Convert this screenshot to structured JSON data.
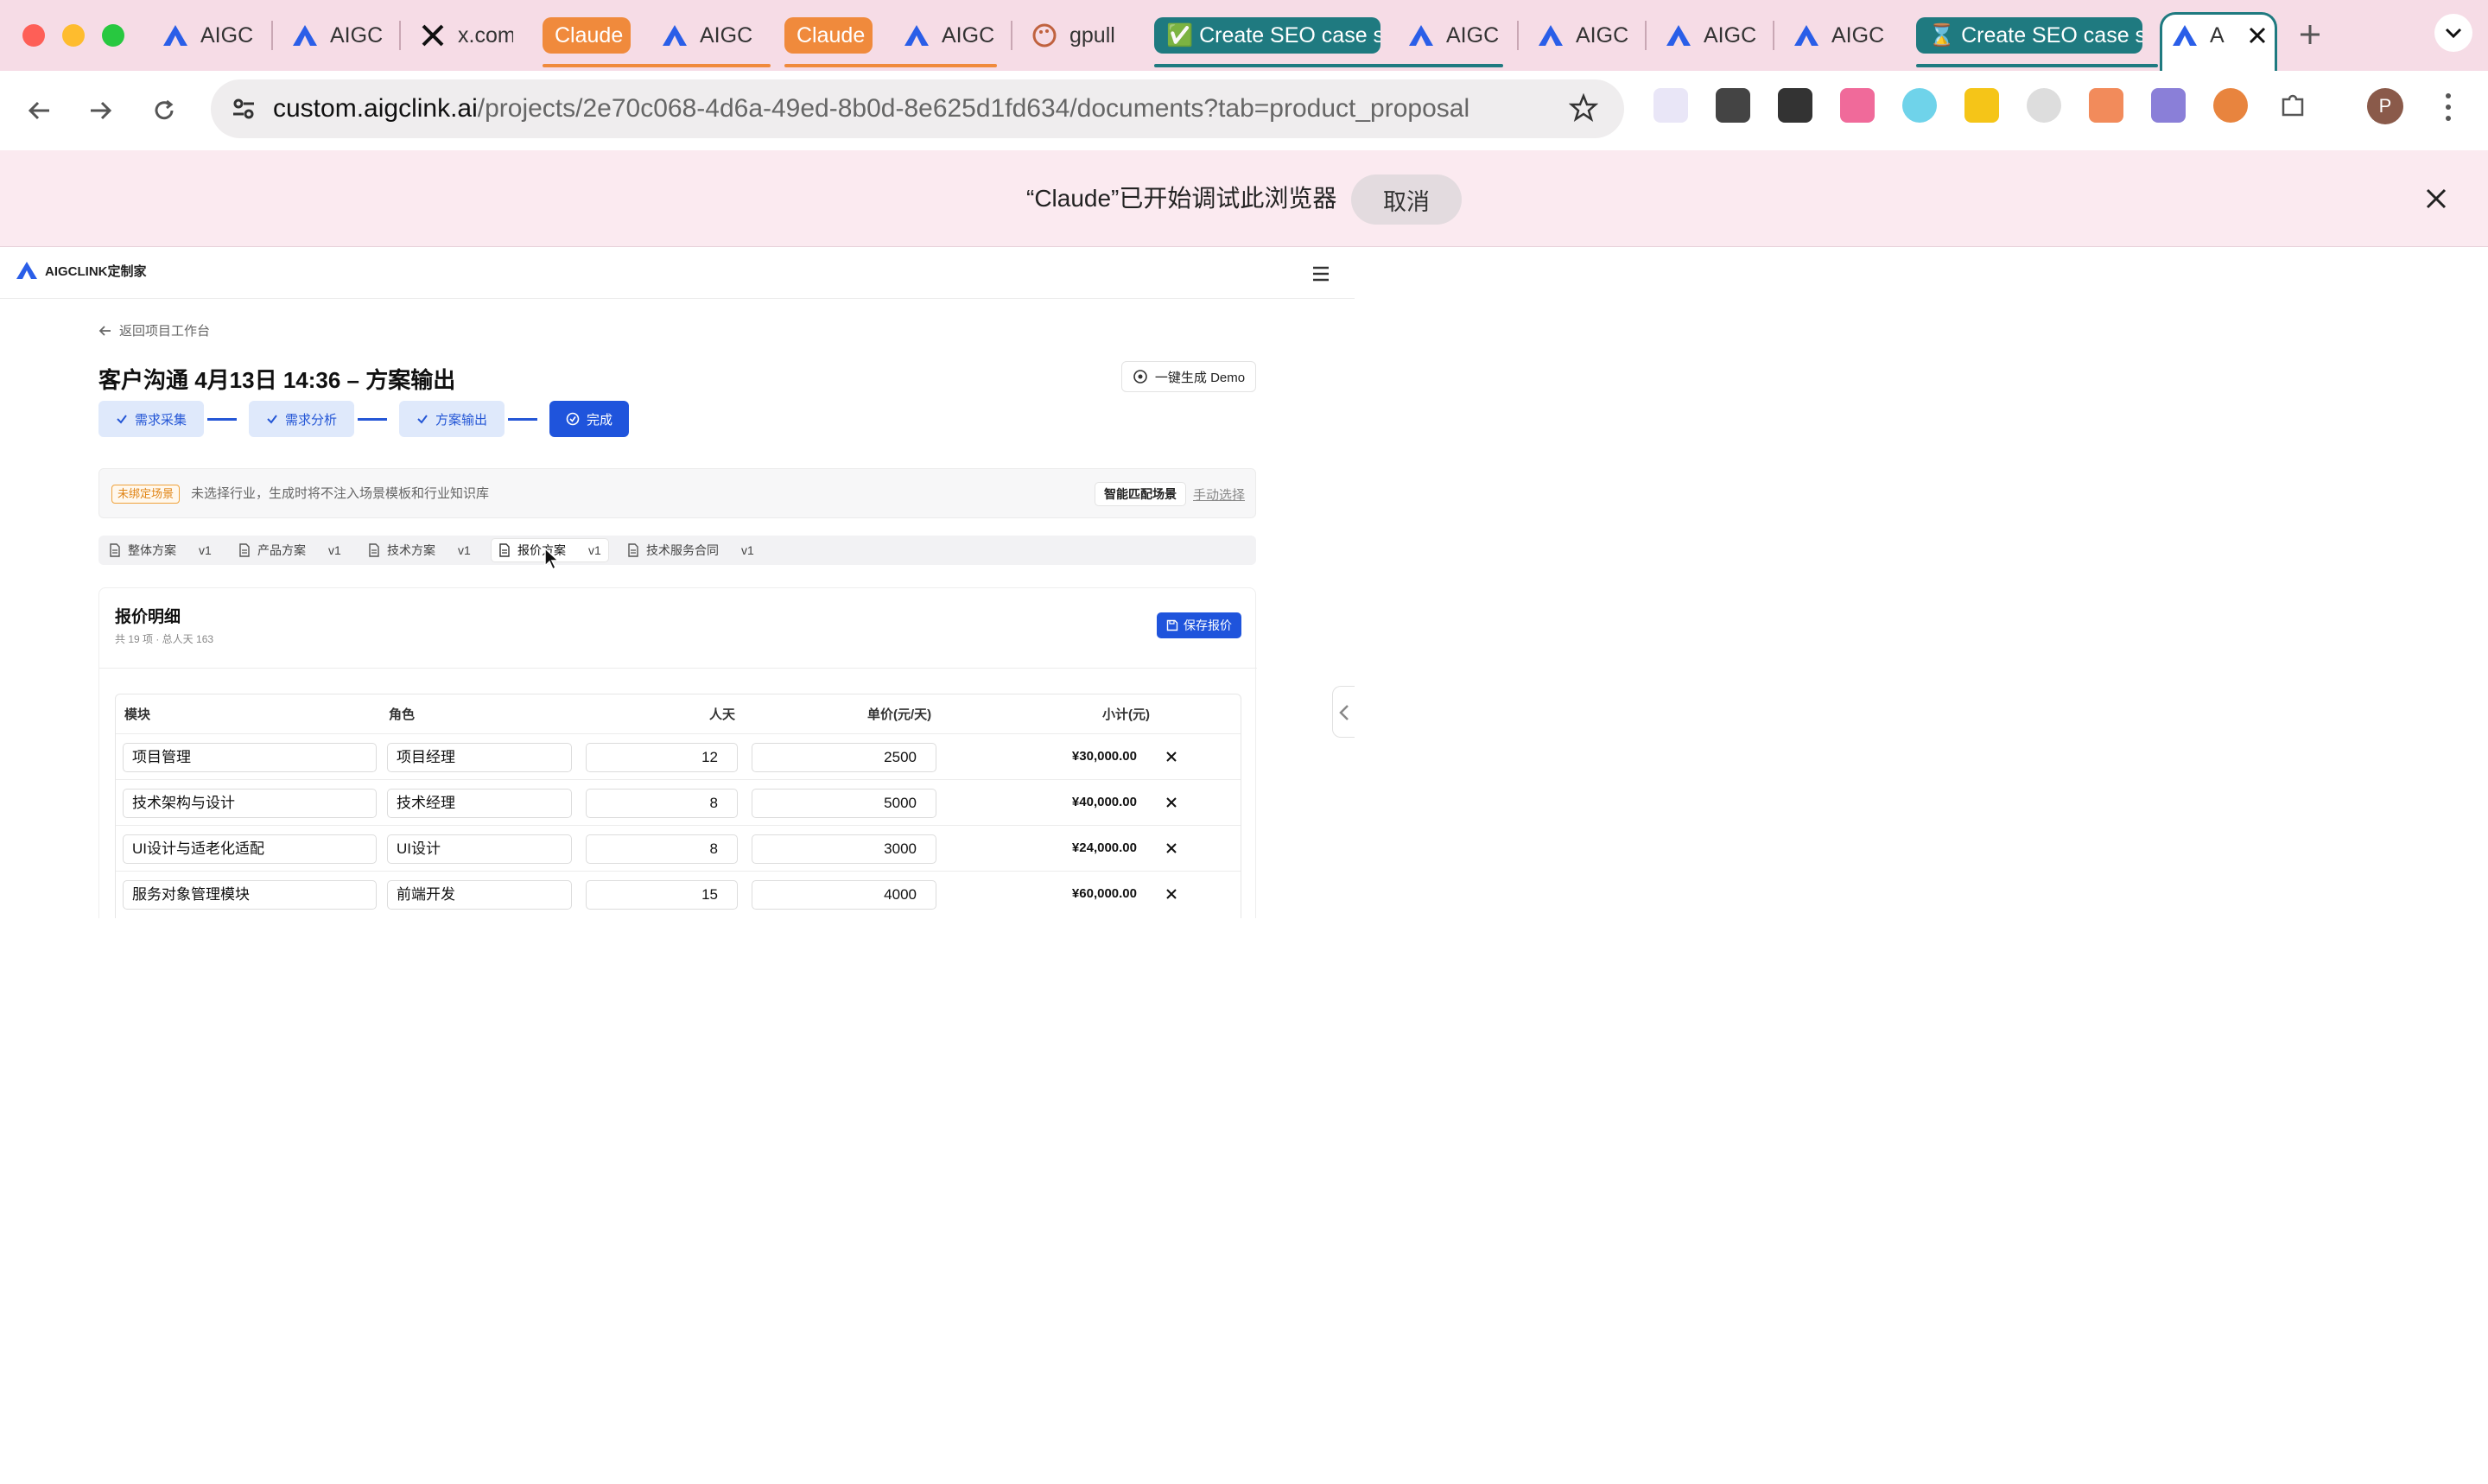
{
  "browser": {
    "tabs": [
      {
        "label": "AIGC",
        "icon": "aigc-logo-icon"
      },
      {
        "label": "AIGC",
        "icon": "aigc-logo-icon"
      },
      {
        "label": "x.com",
        "icon": "x-logo-icon"
      },
      {
        "label": "AIGC",
        "icon": "aigc-logo-icon"
      },
      {
        "label": "AIGC",
        "icon": "aigc-logo-icon"
      },
      {
        "label": "gpull",
        "icon": "palette-icon"
      },
      {
        "label": "AIGC",
        "icon": "aigc-logo-icon"
      },
      {
        "label": "AIGC",
        "icon": "aigc-logo-icon"
      },
      {
        "label": "AIGC",
        "icon": "aigc-logo-icon"
      },
      {
        "label": "AIGC",
        "icon": "aigc-logo-icon"
      },
      {
        "label": "A",
        "icon": "aigc-logo-icon"
      }
    ],
    "groups": {
      "claude1": {
        "label": "Claude",
        "color": "#f08a3c"
      },
      "claude2": {
        "label": "Claude",
        "color": "#f08a3c"
      },
      "seo1": {
        "label": "✅ Create SEO case s",
        "color": "#1f7a80"
      },
      "seo2": {
        "label": "⌛ Create SEO case s",
        "color": "#1f7a80"
      }
    },
    "url_host": "custom.aigclink.ai",
    "url_path": "/projects/2e70c068-4d6a-49ed-8b0d-8e625d1fd634/documents?tab=product_proposal",
    "profile_initial": "P"
  },
  "infobar": {
    "text": "“Claude”已开始调试此浏览器",
    "cancel": "取消"
  },
  "app": {
    "logo_text": "AIGCLINK定制家",
    "back_link": "返回项目工作台",
    "page_title": "客户沟通 4月13日 14:36 – 方案输出",
    "demo_button": "一键生成 Demo",
    "steps": [
      "需求采集",
      "需求分析",
      "方案输出",
      "完成"
    ],
    "banner": {
      "badge": "未绑定场景",
      "text": "未选择行业，生成时将不注入场景模板和行业知识库",
      "smart_button": "智能匹配场景",
      "manual_link": "手动选择"
    },
    "doc_tabs": [
      {
        "label": "整体方案",
        "version": "v1"
      },
      {
        "label": "产品方案",
        "version": "v1"
      },
      {
        "label": "技术方案",
        "version": "v1"
      },
      {
        "label": "报价方案",
        "version": "v1"
      },
      {
        "label": "技术服务合同",
        "version": "v1"
      }
    ],
    "active_doc_tab": "报价方案",
    "quote": {
      "title": "报价明细",
      "summary": "共 19 项 · 总人天 163",
      "save_button": "保存报价",
      "columns": [
        "模块",
        "角色",
        "人天",
        "单价(元/天)",
        "小计(元)"
      ],
      "rows": [
        {
          "module": "项目管理",
          "role": "项目经理",
          "days": "12",
          "price": "2500",
          "subtotal": "¥30,000.00"
        },
        {
          "module": "技术架构与设计",
          "role": "技术经理",
          "days": "8",
          "price": "5000",
          "subtotal": "¥40,000.00"
        },
        {
          "module": "UI设计与适老化适配",
          "role": "UI设计",
          "days": "8",
          "price": "3000",
          "subtotal": "¥24,000.00"
        },
        {
          "module": "服务对象管理模块",
          "role": "前端开发",
          "days": "15",
          "price": "4000",
          "subtotal": "¥60,000.00"
        }
      ]
    }
  }
}
